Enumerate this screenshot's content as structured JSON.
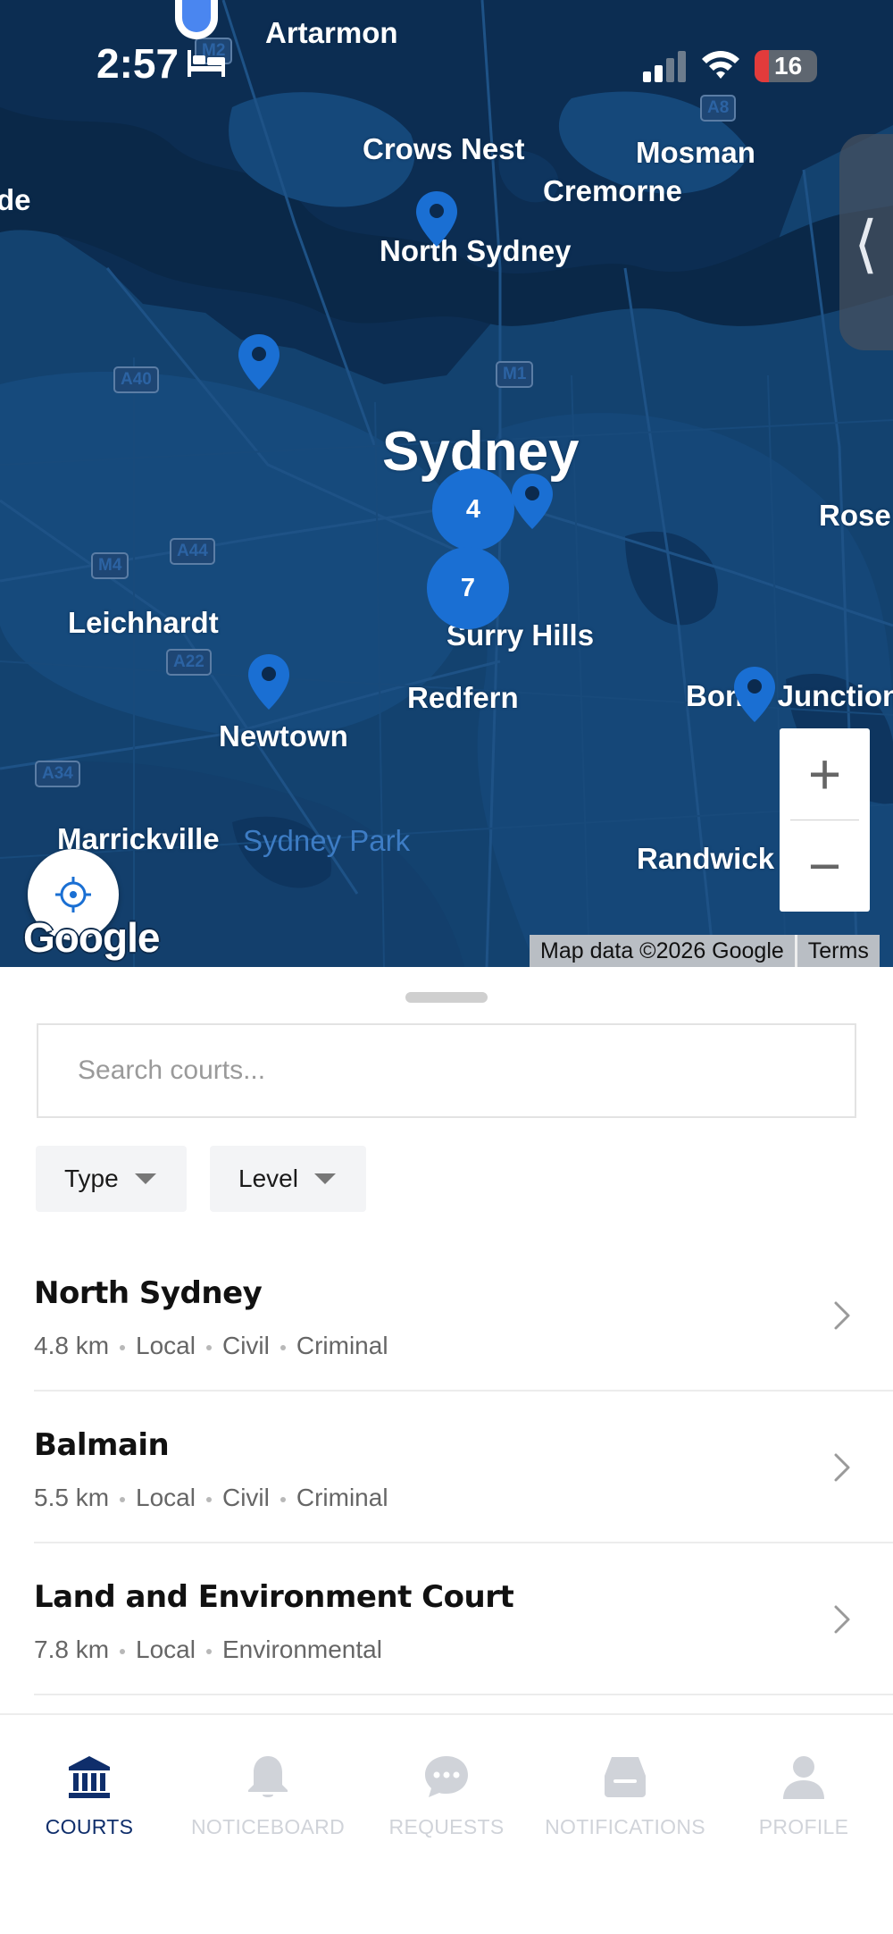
{
  "status_bar": {
    "time": "2:57",
    "battery": "16"
  },
  "map": {
    "places": {
      "artarmon": "Artarmon",
      "crows_nest": "Crows Nest",
      "mosman": "Mosman",
      "cremorne": "Cremorne",
      "north_sydney": "North Sydney",
      "sydney": "Sydney",
      "rose": "Rose",
      "leichhardt": "Leichhardt",
      "surry_hills": "Surry Hills",
      "redfern": "Redfern",
      "bondi_junction": "Bondi Junction",
      "newtown": "Newtown",
      "marrickville": "Marrickville",
      "sydney_park": "Sydney Park",
      "randwick": "Randwick",
      "edge_left": "de"
    },
    "roads": {
      "a8": "A8",
      "a40": "A40",
      "m1": "M1",
      "m4": "M4",
      "a44": "A44",
      "a22": "A22",
      "a34": "A34",
      "m2": "M2"
    },
    "clusters": {
      "c1": "4",
      "c2": "7"
    },
    "zoom_in": "+",
    "zoom_out": "−",
    "side_toggle": "⟨",
    "logo": "Google",
    "attribution": "Map data ©2026 Google",
    "terms": "Terms"
  },
  "sheet": {
    "search_placeholder": "Search courts...",
    "filters": {
      "type": "Type",
      "level": "Level"
    },
    "courts": [
      {
        "name": "North Sydney",
        "distance": "4.8 km",
        "tags": [
          "Local",
          "Civil",
          "Criminal"
        ]
      },
      {
        "name": "Balmain",
        "distance": "5.5 km",
        "tags": [
          "Local",
          "Civil",
          "Criminal"
        ]
      },
      {
        "name": "Land and Environment Court",
        "distance": "7.8 km",
        "tags": [
          "Local",
          "Environmental"
        ]
      }
    ]
  },
  "nav": {
    "tabs": [
      {
        "label": "COURTS",
        "icon": "courthouse-icon",
        "active": true
      },
      {
        "label": "NOTICEBOARD",
        "icon": "bell-icon",
        "active": false
      },
      {
        "label": "REQUESTS",
        "icon": "chat-bubble-icon",
        "active": false
      },
      {
        "label": "NOTIFICATIONS",
        "icon": "inbox-icon",
        "active": false
      },
      {
        "label": "PROFILE",
        "icon": "person-icon",
        "active": false
      }
    ]
  },
  "colors": {
    "map_water": "#0b2a4e",
    "map_land": "#13426f",
    "pin": "#1a6fd3",
    "nav_active": "#0f2e6b",
    "nav_inactive": "#d0d3d9"
  }
}
